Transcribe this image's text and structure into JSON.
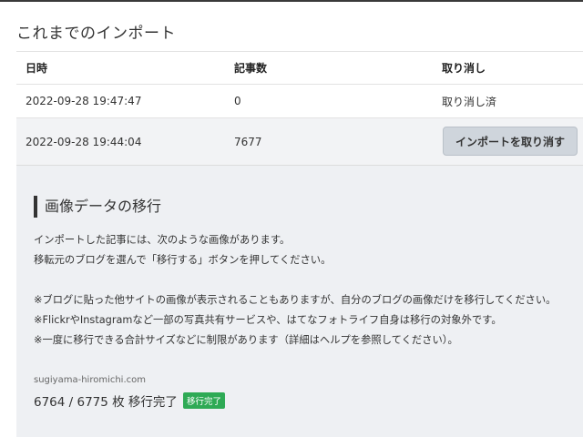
{
  "page": {
    "heading": "これまでのインポート"
  },
  "table": {
    "headers": {
      "date": "日時",
      "count": "記事数",
      "undo": "取り消し"
    },
    "rows": [
      {
        "date": "2022-09-28 19:47:47",
        "count": "0",
        "status": "取り消し済"
      },
      {
        "date": "2022-09-28 19:44:04",
        "count": "7677",
        "button": "インポートを取り消す"
      }
    ]
  },
  "migration": {
    "title": "画像データの移行",
    "lines": [
      "インポートした記事には、次のような画像があります。",
      "移転元のブログを選んで「移行する」ボタンを押してください。"
    ],
    "notes": [
      "※ブログに貼った他サイトの画像が表示されることもありますが、自分のブログの画像だけを移行してください。",
      "※FlickrやInstagramなど一部の写真共有サービスや、はてなフォトライフ自身は移行の対象外です。",
      "※一度に移行できる合計サイズなどに制限があります（詳細はヘルプを参照してください）。"
    ],
    "site": "sugiyama-hiromichi.com",
    "progress_text": "6764 / 6775 枚 移行完了",
    "badge": "移行完了"
  }
}
